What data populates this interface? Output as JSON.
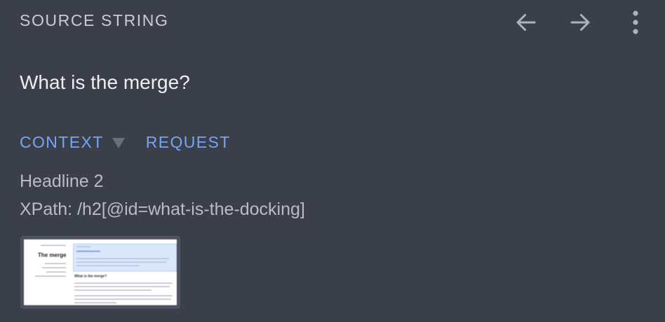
{
  "header": {
    "title": "SOURCE STRING",
    "prev_icon": "arrow-left-icon",
    "next_icon": "arrow-right-icon",
    "more_icon": "more-vertical-icon"
  },
  "source": {
    "text": "What is the merge?"
  },
  "tabs": [
    {
      "label": "CONTEXT",
      "has_caret": true
    },
    {
      "label": "REQUEST",
      "has_caret": false
    }
  ],
  "context": {
    "headline": "Headline 2",
    "xpath": "XPath: /h2[@id=what-is-the-docking]"
  },
  "thumbnail": {
    "title": "The merge",
    "section_heading": "What is the merge?"
  },
  "colors": {
    "background": "#3a3f4a",
    "accent": "#76a5f5",
    "title_text": "#c9ccd2",
    "body_text": "#eceef1",
    "muted_text": "#b9bcc3",
    "icon": "#aeb2ba"
  }
}
